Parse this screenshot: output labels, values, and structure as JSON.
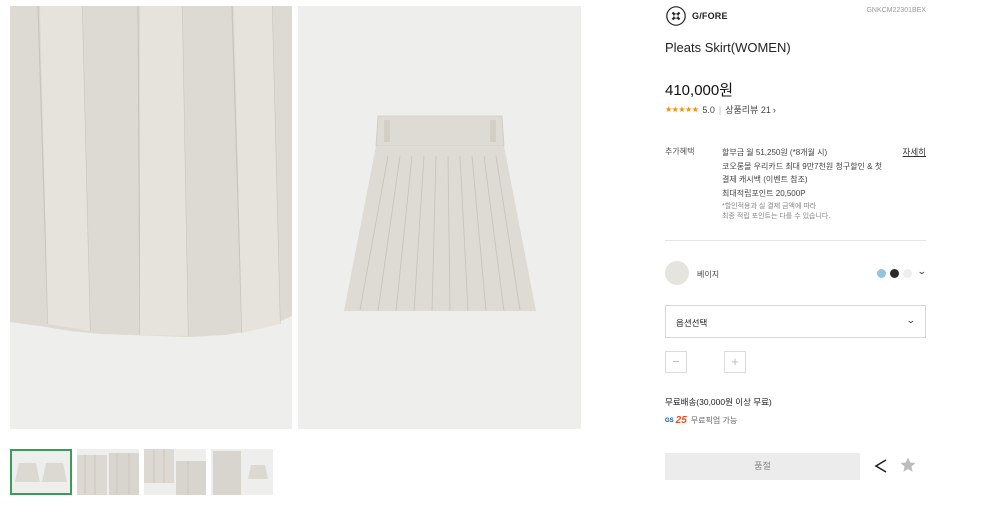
{
  "brand": {
    "name": "G/FORE",
    "logo_icon": "gfore-cross-logo-icon"
  },
  "product": {
    "sku": "GNKCM22301BEX",
    "title": "Pleats Skirt(WOMEN)",
    "price": "410,000원"
  },
  "rating": {
    "stars": "★★★★★",
    "score": "5.0",
    "divider": "|",
    "reviews_label": "상품리뷰 21"
  },
  "benefits": {
    "label": "추가혜택",
    "lines": [
      "할부금 월 51,250원 (*8개월 시)",
      "코오롱몰 우리카드 최대 9만7천원 청구할인 & 첫",
      "결제 캐시백 (이벤트 참조)",
      "최대적립포인트 20,500P"
    ],
    "notes": [
      "*할인적용과 실 결제 금액에 따라",
      "최종 적립 포인트는 다를 수 있습니다."
    ],
    "detail_link": "자세히"
  },
  "color": {
    "selected_name": "베이지",
    "selected_color": "#e6e4df",
    "swatches": [
      {
        "name": "sky-blue",
        "hex": "#8ec6e0"
      },
      {
        "name": "black",
        "hex": "#2b2b2b"
      },
      {
        "name": "white",
        "hex": "#eeeeee"
      }
    ]
  },
  "option": {
    "placeholder": "옵션선택"
  },
  "quantity": {
    "minus": "−",
    "plus": "+"
  },
  "shipping": {
    "free_label": "무료배송(30,000원 이상 무료)",
    "gs_logo": "GS",
    "gs_number": "25",
    "pickup_label": "무료픽업 가능"
  },
  "actions": {
    "soldout_label": "품절",
    "share_icon": "share-icon",
    "wishlist_icon": "star-icon"
  },
  "colors": {
    "soldout_bg": "#ececec",
    "image_bg": "#eeeeec",
    "thumb_active": "#3c9a5f",
    "stars": "#ff8a00"
  }
}
